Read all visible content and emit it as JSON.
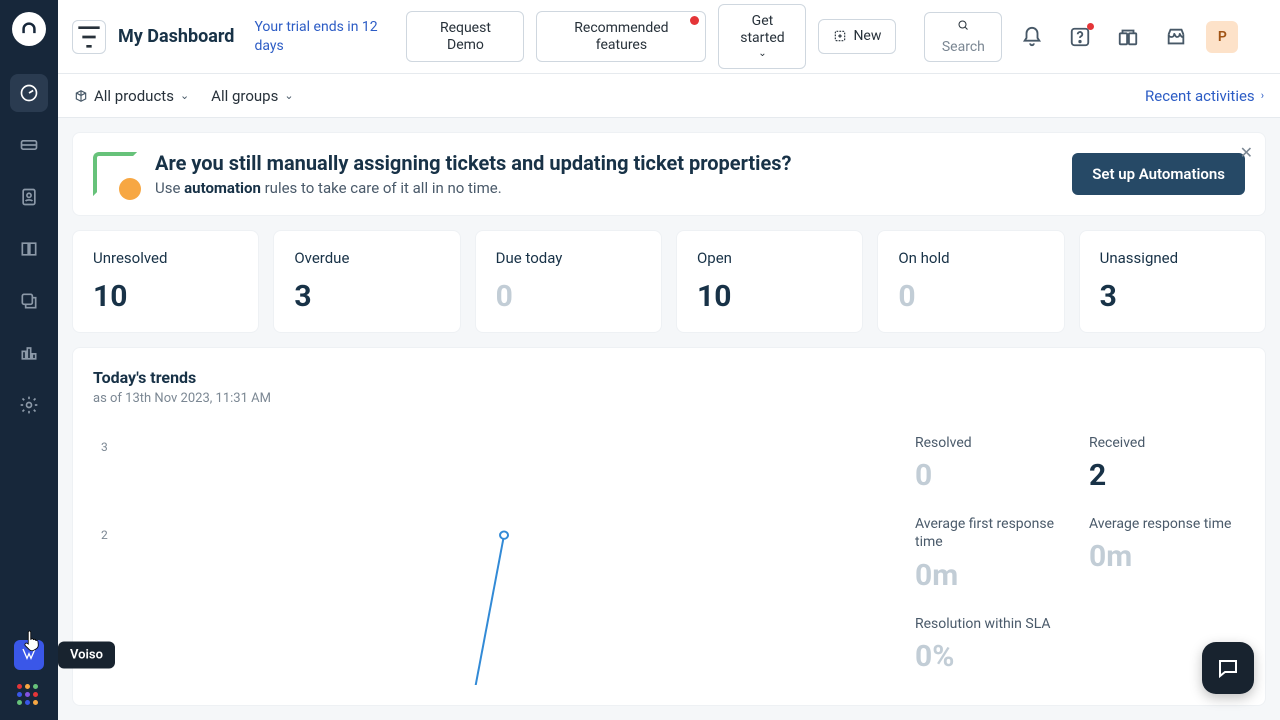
{
  "sidebar": {
    "tooltip_voiso": "Voiso"
  },
  "header": {
    "title": "My Dashboard",
    "trial": "Your trial ends in 12 days",
    "request_demo": "Request Demo",
    "recommended_features": "Recommended features",
    "get_started": "Get started",
    "new_label": "New",
    "search_placeholder": "Search",
    "avatar_initial": "P"
  },
  "subhead": {
    "all_products": "All products",
    "all_groups": "All groups",
    "recent_activities": "Recent activities"
  },
  "banner": {
    "heading": "Are you still manually assigning tickets and updating ticket properties?",
    "text_prefix": "Use ",
    "text_bold": "automation",
    "text_suffix": " rules to take care of it all in no time.",
    "cta": "Set up Automations"
  },
  "stats": [
    {
      "label": "Unresolved",
      "value": "10",
      "zero": false
    },
    {
      "label": "Overdue",
      "value": "3",
      "zero": false
    },
    {
      "label": "Due today",
      "value": "0",
      "zero": true
    },
    {
      "label": "Open",
      "value": "10",
      "zero": false
    },
    {
      "label": "On hold",
      "value": "0",
      "zero": true
    },
    {
      "label": "Unassigned",
      "value": "3",
      "zero": false
    }
  ],
  "trends": {
    "title": "Today's trends",
    "asof": "as of 13th Nov 2023, 11:31 AM",
    "side": {
      "resolved_label": "Resolved",
      "resolved_value": "0",
      "received_label": "Received",
      "received_value": "2",
      "afrt_label": "Average first response time",
      "afrt_value": "0m",
      "art_label": "Average response time",
      "art_value": "0m",
      "sla_label": "Resolution within SLA",
      "sla_value": "0%"
    }
  },
  "chart_data": {
    "type": "line",
    "title": "Today's trends",
    "ylabel": "",
    "xlabel": "",
    "ylim": [
      0,
      3
    ],
    "y_ticks": [
      2,
      3
    ],
    "series": [
      {
        "name": "Received",
        "values": [
          0,
          2
        ],
        "color": "#328ad6"
      }
    ]
  },
  "colors": {
    "accent": "#2c5cc5",
    "dark": "#264966",
    "danger": "#e43538"
  }
}
